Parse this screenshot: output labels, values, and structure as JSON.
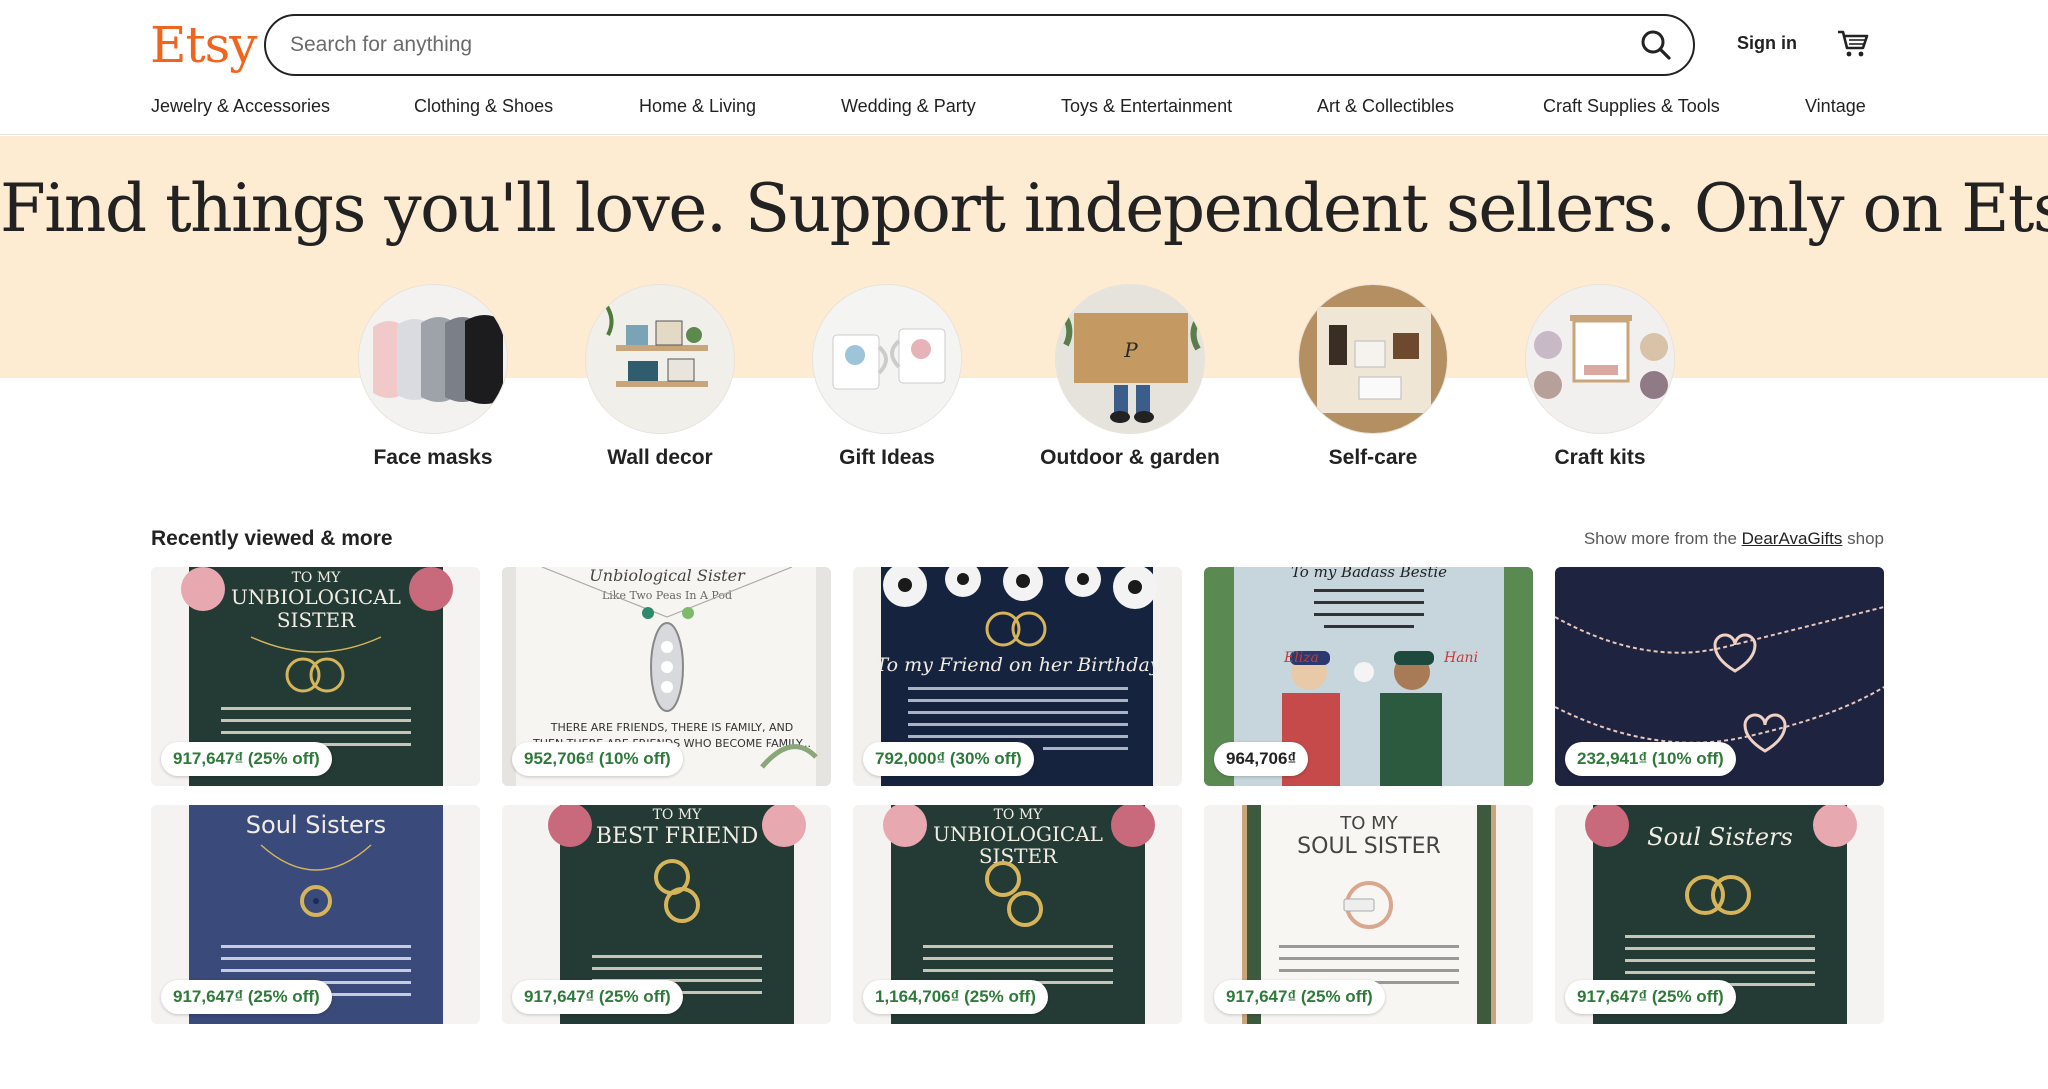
{
  "header": {
    "logo": "Etsy",
    "search_placeholder": "Search for anything",
    "search_icon": "search-icon",
    "signin_label": "Sign in",
    "cart_icon": "shopping-cart-icon"
  },
  "nav": {
    "items": [
      "Jewelry & Accessories",
      "Clothing & Shoes",
      "Home & Living",
      "Wedding & Party",
      "Toys & Entertainment",
      "Art & Collectibles",
      "Craft Supplies & Tools",
      "Vintage"
    ]
  },
  "hero": {
    "headline": "Find things you'll love. Support independent sellers. Only on Etsy."
  },
  "categories": [
    {
      "label": "Face masks"
    },
    {
      "label": "Wall decor"
    },
    {
      "label": "Gift Ideas"
    },
    {
      "label": "Outdoor & garden"
    },
    {
      "label": "Self-care"
    },
    {
      "label": "Craft kits"
    }
  ],
  "recent": {
    "title": "Recently viewed & more",
    "show_more_prefix": "Show more from the ",
    "shop_name": "DearAvaGifts",
    "show_more_suffix": " shop",
    "items": [
      {
        "price": "917,647₫ (25% off)",
        "card_text": [
          "TO MY",
          "UNBIOLOGICAL",
          "SISTER"
        ]
      },
      {
        "price": "952,706₫ (10% off)",
        "card_text": [
          "Unbiological Sister",
          "Like Two Peas In A Pod",
          "THERE ARE FRIENDS, THERE IS FAMILY, AND",
          "THEN THERE ARE FRIENDS WHO BECOME FAMILY..."
        ]
      },
      {
        "price": "792,000₫ (30% off)",
        "card_text": [
          "To my Friend on her Birthday"
        ]
      },
      {
        "price": "964,706₫",
        "card_text": [
          "To my Badass Bestie",
          "Eliza",
          "Hani"
        ]
      },
      {
        "price": "232,941₫ (10% off)",
        "card_text": []
      },
      {
        "price": "917,647₫ (25% off)",
        "card_text": [
          "Soul Sisters"
        ]
      },
      {
        "price": "917,647₫ (25% off)",
        "card_text": [
          "TO MY",
          "BEST FRIEND"
        ]
      },
      {
        "price": "1,164,706₫ (25% off)",
        "card_text": [
          "TO MY",
          "UNBIOLOGICAL",
          "SISTER"
        ]
      },
      {
        "price": "917,647₫ (25% off)",
        "card_text": [
          "TO MY",
          "SOUL SISTER"
        ]
      },
      {
        "price": "917,647₫ (25% off)",
        "card_text": [
          "Soul Sisters"
        ]
      }
    ]
  },
  "colors": {
    "brand": "#F1641E",
    "hero_bg": "#FDEBD2",
    "price_green": "#2F7A3A"
  }
}
